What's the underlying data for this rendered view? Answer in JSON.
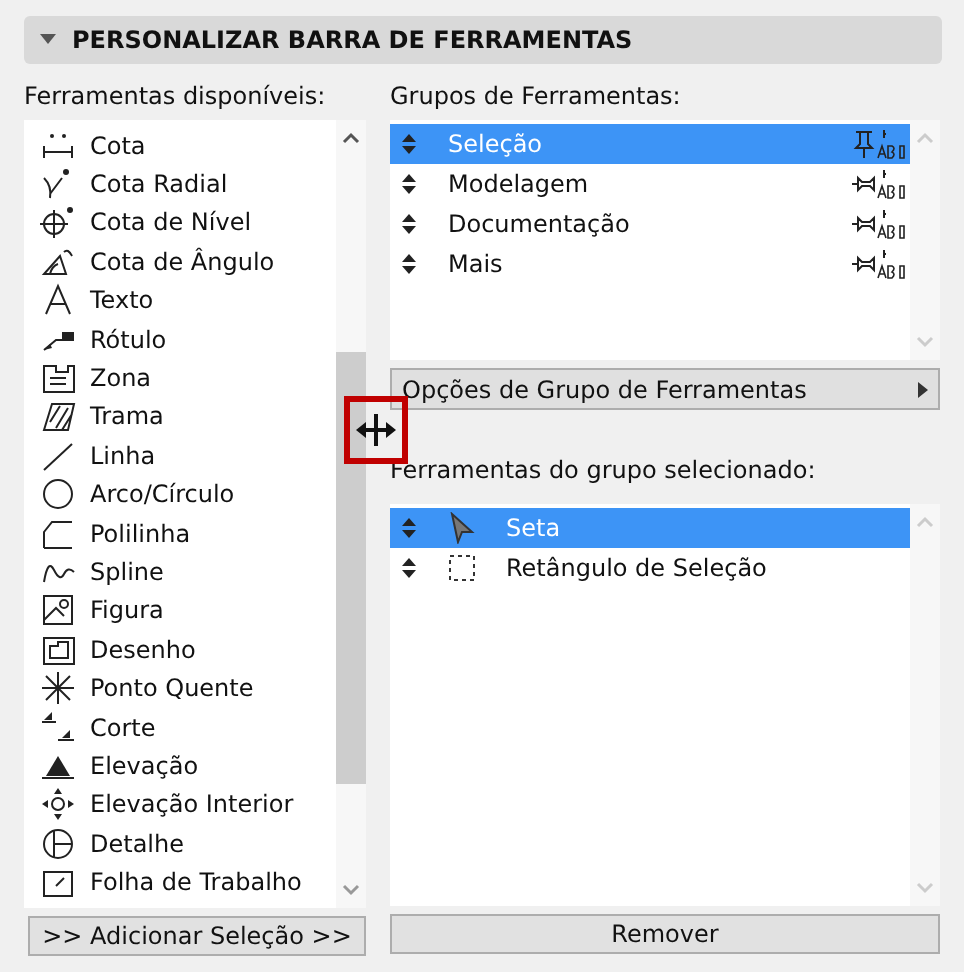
{
  "section": {
    "title": "PERSONALIZAR BARRA DE FERRAMENTAS",
    "expanded": true
  },
  "available_tools": {
    "label": "Ferramentas disponíveis:",
    "items": [
      {
        "label": "Cota"
      },
      {
        "label": "Cota Radial"
      },
      {
        "label": "Cota de Nível"
      },
      {
        "label": "Cota de Ângulo"
      },
      {
        "label": "Texto"
      },
      {
        "label": "Rótulo"
      },
      {
        "label": "Zona"
      },
      {
        "label": "Trama"
      },
      {
        "label": "Linha"
      },
      {
        "label": "Arco/Círculo"
      },
      {
        "label": "Polilinha"
      },
      {
        "label": "Spline"
      },
      {
        "label": "Figura"
      },
      {
        "label": "Desenho"
      },
      {
        "label": "Ponto Quente"
      },
      {
        "label": "Corte"
      },
      {
        "label": "Elevação"
      },
      {
        "label": "Elevação Interior"
      },
      {
        "label": "Detalhe"
      },
      {
        "label": "Folha de Trabalho"
      }
    ],
    "button": ">> Adicionar Seleção >>"
  },
  "tool_groups": {
    "label": "Grupos de Ferramentas:",
    "items": [
      {
        "label": "Seleção",
        "selected": true,
        "pinned": true
      },
      {
        "label": "Modelagem",
        "selected": false,
        "pinned": false
      },
      {
        "label": "Documentação",
        "selected": false,
        "pinned": false
      },
      {
        "label": "Mais",
        "selected": false,
        "pinned": false
      }
    ],
    "options": "Opções de Grupo de Ferramentas"
  },
  "group_tools": {
    "label": "Ferramentas do grupo selecionado:",
    "items": [
      {
        "label": "Seta",
        "selected": true,
        "kind": "arrow"
      },
      {
        "label": "Retângulo de Seleção",
        "selected": false,
        "kind": "marquee"
      }
    ],
    "button": "Remover"
  }
}
